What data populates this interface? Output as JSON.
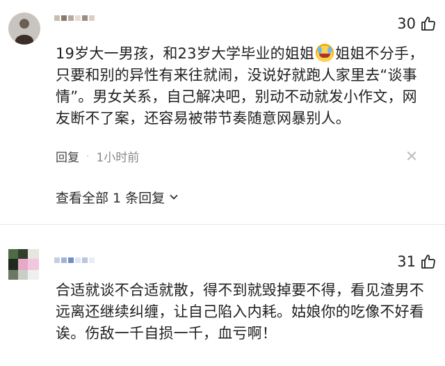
{
  "comments": [
    {
      "likes": "30",
      "text_part1": "19岁大一男孩，和23岁大学毕业的姐姐",
      "emoji": "crying-laughing-emoji",
      "text_part2": "姐姐不分手，只要和别的异性有来往就闹，没说好就跑人家里去“谈事情”。男女关系，自己解决吧，别动不动就发小作文，网友断不了案，还容易被带节奏随意网暴别人。",
      "reply_label": "回复",
      "time": "1小时前",
      "view_all": "查看全部 1 条回复"
    },
    {
      "likes": "31",
      "text": "合适就谈不合适就散，得不到就毁掉要不得，看见渣男不远离还继续纠缠，让自己陷入内耗。姑娘你的吃像不好看诶。伤敌一千自损一千，血亏啊！"
    }
  ],
  "colors": {
    "text": "#1f1f1f",
    "muted": "#888888",
    "divider": "#e6e6e6"
  }
}
